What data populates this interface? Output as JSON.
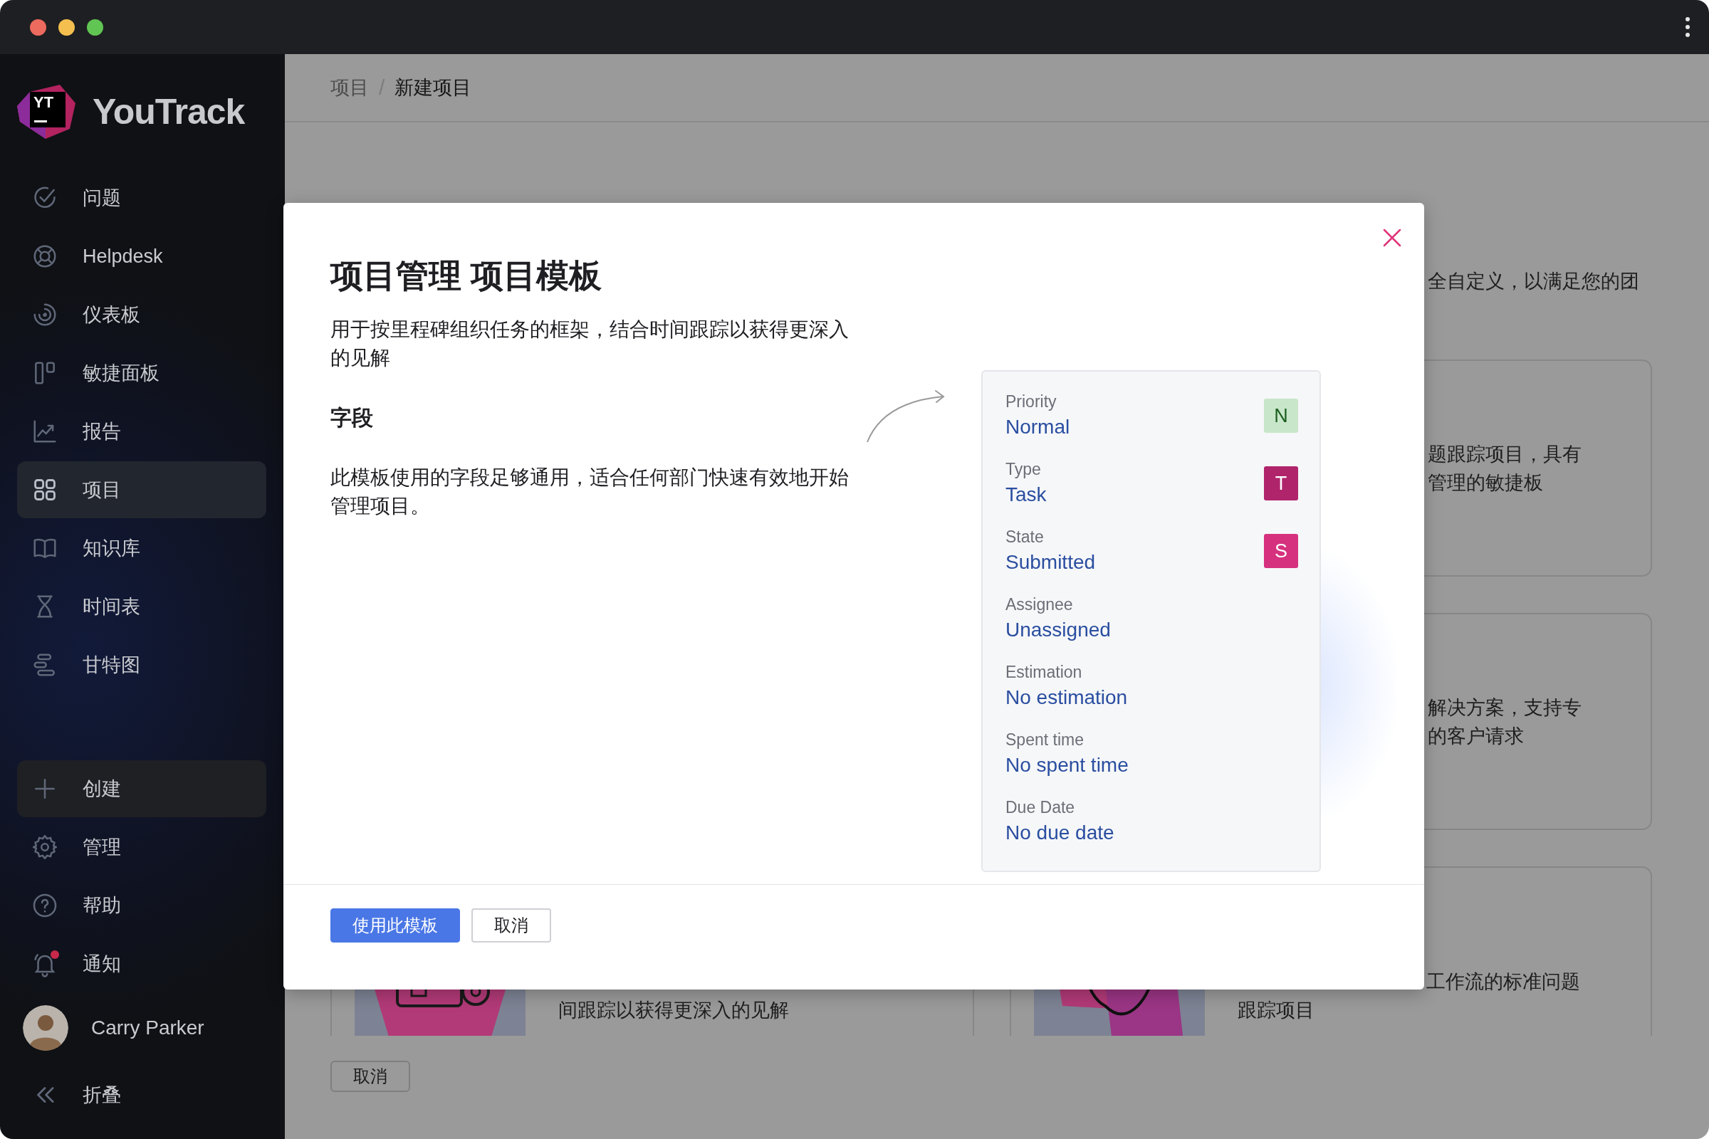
{
  "sidebar": {
    "logo": {
      "mark": "YT",
      "name": "YouTrack"
    },
    "nav": [
      {
        "label": "问题",
        "selected": false
      },
      {
        "label": "Helpdesk",
        "selected": false
      },
      {
        "label": "仪表板",
        "selected": false
      },
      {
        "label": "敏捷面板",
        "selected": false
      },
      {
        "label": "报告",
        "selected": false
      },
      {
        "label": "项目",
        "selected": true
      },
      {
        "label": "知识库",
        "selected": false
      },
      {
        "label": "时间表",
        "selected": false
      },
      {
        "label": "甘特图",
        "selected": false
      }
    ],
    "create": {
      "label": "创建"
    },
    "bottom": [
      {
        "label": "管理",
        "unread": false
      },
      {
        "label": "帮助",
        "unread": false
      },
      {
        "label": "通知",
        "unread": true
      }
    ],
    "user": {
      "name": "Carry Parker"
    },
    "collapse": {
      "label": "折叠"
    }
  },
  "breadcrumb": {
    "separator": "/",
    "items": [
      {
        "label": "项目",
        "current": false
      },
      {
        "label": "新建项目",
        "current": true
      }
    ]
  },
  "background": {
    "intro": "全自定义，以满足您的团",
    "cards": [
      {
        "lines": [
          "题跟踪项目，具有",
          "管理的敏捷板"
        ]
      },
      {
        "lines": [
          "解决方案，支持专",
          "的客户请求"
        ]
      }
    ],
    "bottom_cards": [
      {
        "lines": [
          "间跟踪以获得更深入的见解"
        ]
      },
      {
        "lines": [
          "工作流的标准问题",
          "跟踪项目"
        ]
      }
    ],
    "cancel_button": "取消"
  },
  "modal": {
    "title": "项目管理 项目模板",
    "description": "用于按里程碑组织任务的框架，结合时间跟踪以获得更深入的见解",
    "section_title": "字段",
    "section_text": "此模板使用的字段足够通用，适合任何部门快速有效地开始管理项目。",
    "fields": [
      {
        "label": "Priority",
        "value": "Normal",
        "badge": {
          "letter": "N",
          "color": "#c8e6c9"
        }
      },
      {
        "label": "Type",
        "value": "Task",
        "badge": {
          "letter": "T",
          "color": "#b0246b"
        }
      },
      {
        "label": "State",
        "value": "Submitted",
        "badge": {
          "letter": "S",
          "color": "#d6317e"
        }
      },
      {
        "label": "Assignee",
        "value": "Unassigned"
      },
      {
        "label": "Estimation",
        "value": "No estimation"
      },
      {
        "label": "Spent time",
        "value": "No spent time"
      },
      {
        "label": "Due Date",
        "value": "No due date"
      }
    ],
    "buttons": [
      {
        "label": "使用此模板",
        "kind": "primary"
      },
      {
        "label": "取消",
        "kind": "secondary"
      }
    ]
  }
}
